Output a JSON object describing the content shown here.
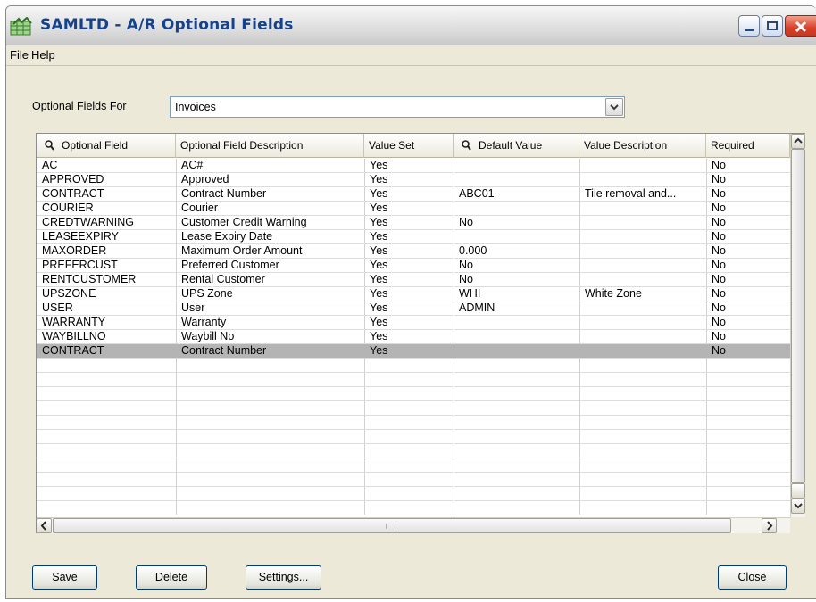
{
  "window": {
    "title": "SAMLTD - A/R Optional Fields",
    "app_icon": "grid-icon"
  },
  "menu": [
    "File",
    "Help"
  ],
  "optional_fields_for": {
    "label": "Optional Fields For",
    "value": "Invoices"
  },
  "table": {
    "columns": [
      "Optional Field",
      "Optional Field Description",
      "Value Set",
      "Default Value",
      "Value Description",
      "Required"
    ],
    "rows": [
      [
        "AC",
        "AC#",
        "Yes",
        "",
        "",
        "No"
      ],
      [
        "APPROVED",
        "Approved",
        "Yes",
        "",
        "",
        "No"
      ],
      [
        "CONTRACT",
        "Contract Number",
        "Yes",
        "ABC01",
        "Tile removal and...",
        "No"
      ],
      [
        "COURIER",
        "Courier",
        "Yes",
        "",
        "",
        "No"
      ],
      [
        "CREDTWARNING",
        "Customer Credit Warning",
        "Yes",
        "No",
        "",
        "No"
      ],
      [
        "LEASEEXPIRY",
        "Lease Expiry Date",
        "Yes",
        "",
        "",
        "No"
      ],
      [
        "MAXORDER",
        "Maximum Order Amount",
        "Yes",
        "0.000",
        "",
        "No"
      ],
      [
        "PREFERCUST",
        "Preferred Customer",
        "Yes",
        "No",
        "",
        "No"
      ],
      [
        "RENTCUSTOMER",
        "Rental Customer",
        "Yes",
        "No",
        "",
        "No"
      ],
      [
        "UPSZONE",
        "UPS Zone",
        "Yes",
        "WHI",
        "White Zone",
        "No"
      ],
      [
        "USER",
        "User",
        "Yes",
        "ADMIN",
        "",
        "No"
      ],
      [
        "WARRANTY",
        "Warranty",
        "Yes",
        "",
        "",
        "No"
      ],
      [
        "WAYBILLNO",
        "Waybill No",
        "Yes",
        "",
        "",
        "No"
      ],
      [
        "CONTRACT",
        "Contract Number",
        "Yes",
        "",
        "",
        "No"
      ]
    ],
    "selected_row": 13
  },
  "buttons": {
    "save": "Save",
    "delete": "Delete",
    "settings": "Settings...",
    "close": "Close"
  },
  "colors": {
    "title_text": "#15428b",
    "selected_row": "#b4b4b4",
    "window_bg": "#ece9d8"
  }
}
